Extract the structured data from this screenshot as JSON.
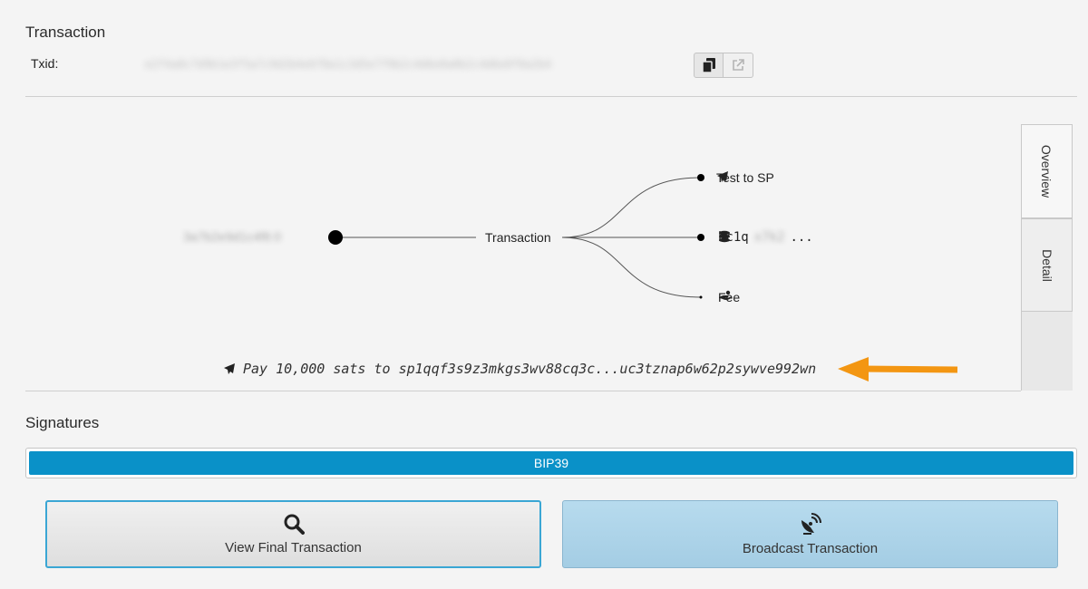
{
  "transaction": {
    "heading": "Transaction",
    "txid_label": "Txid:",
    "txid_value": "e2f4a8c7d9b1e3f5a7c9d2b4e6f8a1c3d5e7f9b2c4d6e8a0b2c4d6e8f0a2b4",
    "copy_icon": "copy-icon",
    "open_icon": "external-link-icon"
  },
  "diagram": {
    "input_label": "3a7b2e9d1c4f6:0",
    "center_label": "Transaction",
    "outputs": [
      {
        "icon": "send-icon",
        "label": "Test to SP"
      },
      {
        "icon": "coins-icon",
        "label_prefix": "bc1q",
        "label_hidden": "x7k2",
        "label_suffix": "..."
      },
      {
        "icon": "fee-hand-icon",
        "label": "Fee"
      }
    ],
    "payment_summary": "Pay 10,000 sats to sp1qqf3s9z3mkgs3wv88cq3c...uc3tznap6w62p2sywve992wn",
    "arrow_color": "#f39612"
  },
  "tabs": {
    "overview": "Overview",
    "detail": "Detail"
  },
  "signatures": {
    "heading": "Signatures",
    "bar_label": "BIP39",
    "bar_color": "#0a91c8"
  },
  "actions": {
    "view": {
      "label": "View Final Transaction",
      "icon": "search-icon"
    },
    "broadcast": {
      "label": "Broadcast Transaction",
      "icon": "satellite-dish-icon"
    }
  }
}
